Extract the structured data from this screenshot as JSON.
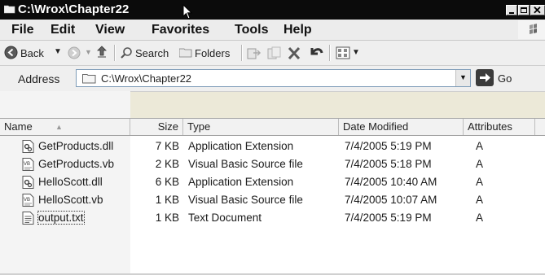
{
  "window": {
    "title": "C:\\Wrox\\Chapter22"
  },
  "menu": {
    "items": [
      {
        "label": "File"
      },
      {
        "label": "Edit"
      },
      {
        "label": "View"
      },
      {
        "label": "Favorites"
      },
      {
        "label": "Tools"
      },
      {
        "label": "Help"
      }
    ]
  },
  "toolbar": {
    "back_label": "Back",
    "search_label": "Search",
    "folders_label": "Folders"
  },
  "address": {
    "label": "Address",
    "value": "C:\\Wrox\\Chapter22",
    "go_label": "Go"
  },
  "columns": {
    "name": "Name",
    "size": "Size",
    "type": "Type",
    "modified": "Date Modified",
    "attributes": "Attributes"
  },
  "files": [
    {
      "name": "GetProducts.dll",
      "size": "7 KB",
      "type": "Application Extension",
      "modified": "7/4/2005 5:19 PM",
      "attributes": "A",
      "icon": "dll-file-icon"
    },
    {
      "name": "GetProducts.vb",
      "size": "2 KB",
      "type": "Visual Basic Source file",
      "modified": "7/4/2005 5:18 PM",
      "attributes": "A",
      "icon": "vb-file-icon"
    },
    {
      "name": "HelloScott.dll",
      "size": "6 KB",
      "type": "Application Extension",
      "modified": "7/4/2005 10:40 AM",
      "attributes": "A",
      "icon": "dll-file-icon"
    },
    {
      "name": "HelloScott.vb",
      "size": "1 KB",
      "type": "Visual Basic Source file",
      "modified": "7/4/2005 10:07 AM",
      "attributes": "A",
      "icon": "vb-file-icon"
    },
    {
      "name": "output.txt",
      "size": "1 KB",
      "type": "Text Document",
      "modified": "7/4/2005 5:19 PM",
      "attributes": "A",
      "icon": "text-file-icon"
    }
  ]
}
